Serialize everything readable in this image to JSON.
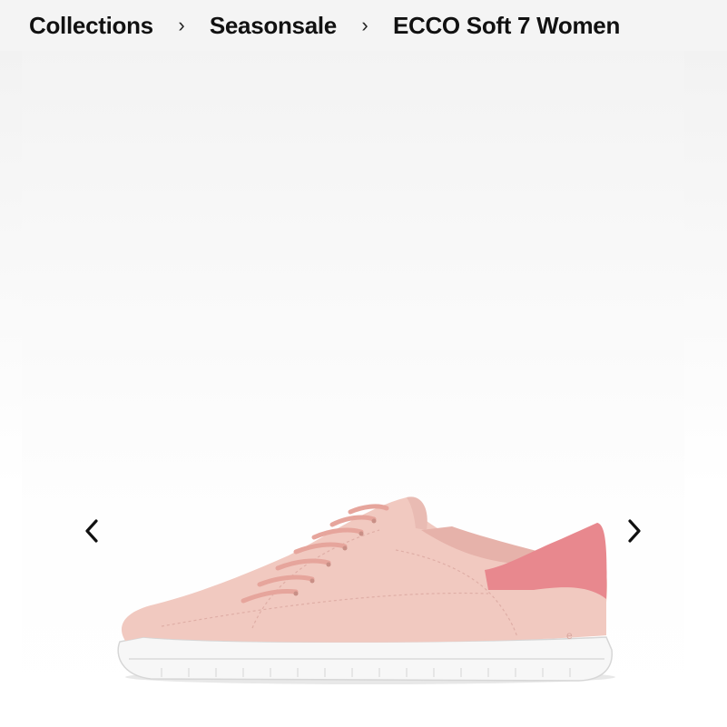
{
  "breadcrumb": {
    "items": [
      {
        "label": "Collections"
      },
      {
        "label": "Seasonsale"
      },
      {
        "label": "ECCO Soft 7 Women"
      }
    ],
    "separator": "›"
  },
  "gallery": {
    "image_alt": "ECCO Soft 7 Women sneaker in light pink with coral heel tab",
    "prev_icon": "chevron-left-icon",
    "next_icon": "chevron-right-icon"
  },
  "colors": {
    "upper": "#f1c9c0",
    "heel_tab": "#e8888e",
    "sole": "#ffffff",
    "text": "#111111"
  }
}
